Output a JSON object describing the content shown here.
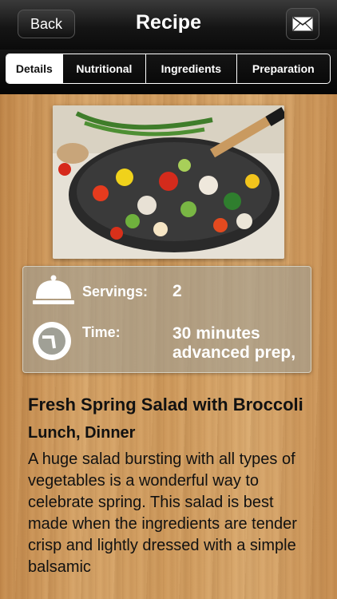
{
  "navbar": {
    "back_label": "Back",
    "title": "Recipe",
    "mail_icon": "envelope-icon"
  },
  "tabs": [
    {
      "label": "Details",
      "active": true
    },
    {
      "label": "Nutritional",
      "active": false
    },
    {
      "label": "Ingredients",
      "active": false
    },
    {
      "label": "Preparation",
      "active": false
    }
  ],
  "info": {
    "servings_label": "Servings:",
    "servings_value": "2",
    "time_label": "Time:",
    "time_value_line1": "30 minutes",
    "time_value_line2": "advanced prep,",
    "servings_icon": "serving-cloche-icon",
    "time_icon": "clock-icon"
  },
  "recipe": {
    "title": "Fresh Spring Salad with Broccoli",
    "meal": "Lunch, Dinner",
    "description": "A huge salad bursting with all types of vegetables is a wonderful way to celebrate spring. This salad is best made when the ingredients are tender crisp and lightly dressed with a simple balsamic"
  },
  "colors": {
    "navbar": "#111111",
    "wood": "#d0a064",
    "info_panel": "#a0a096",
    "text_dark": "#111111"
  }
}
